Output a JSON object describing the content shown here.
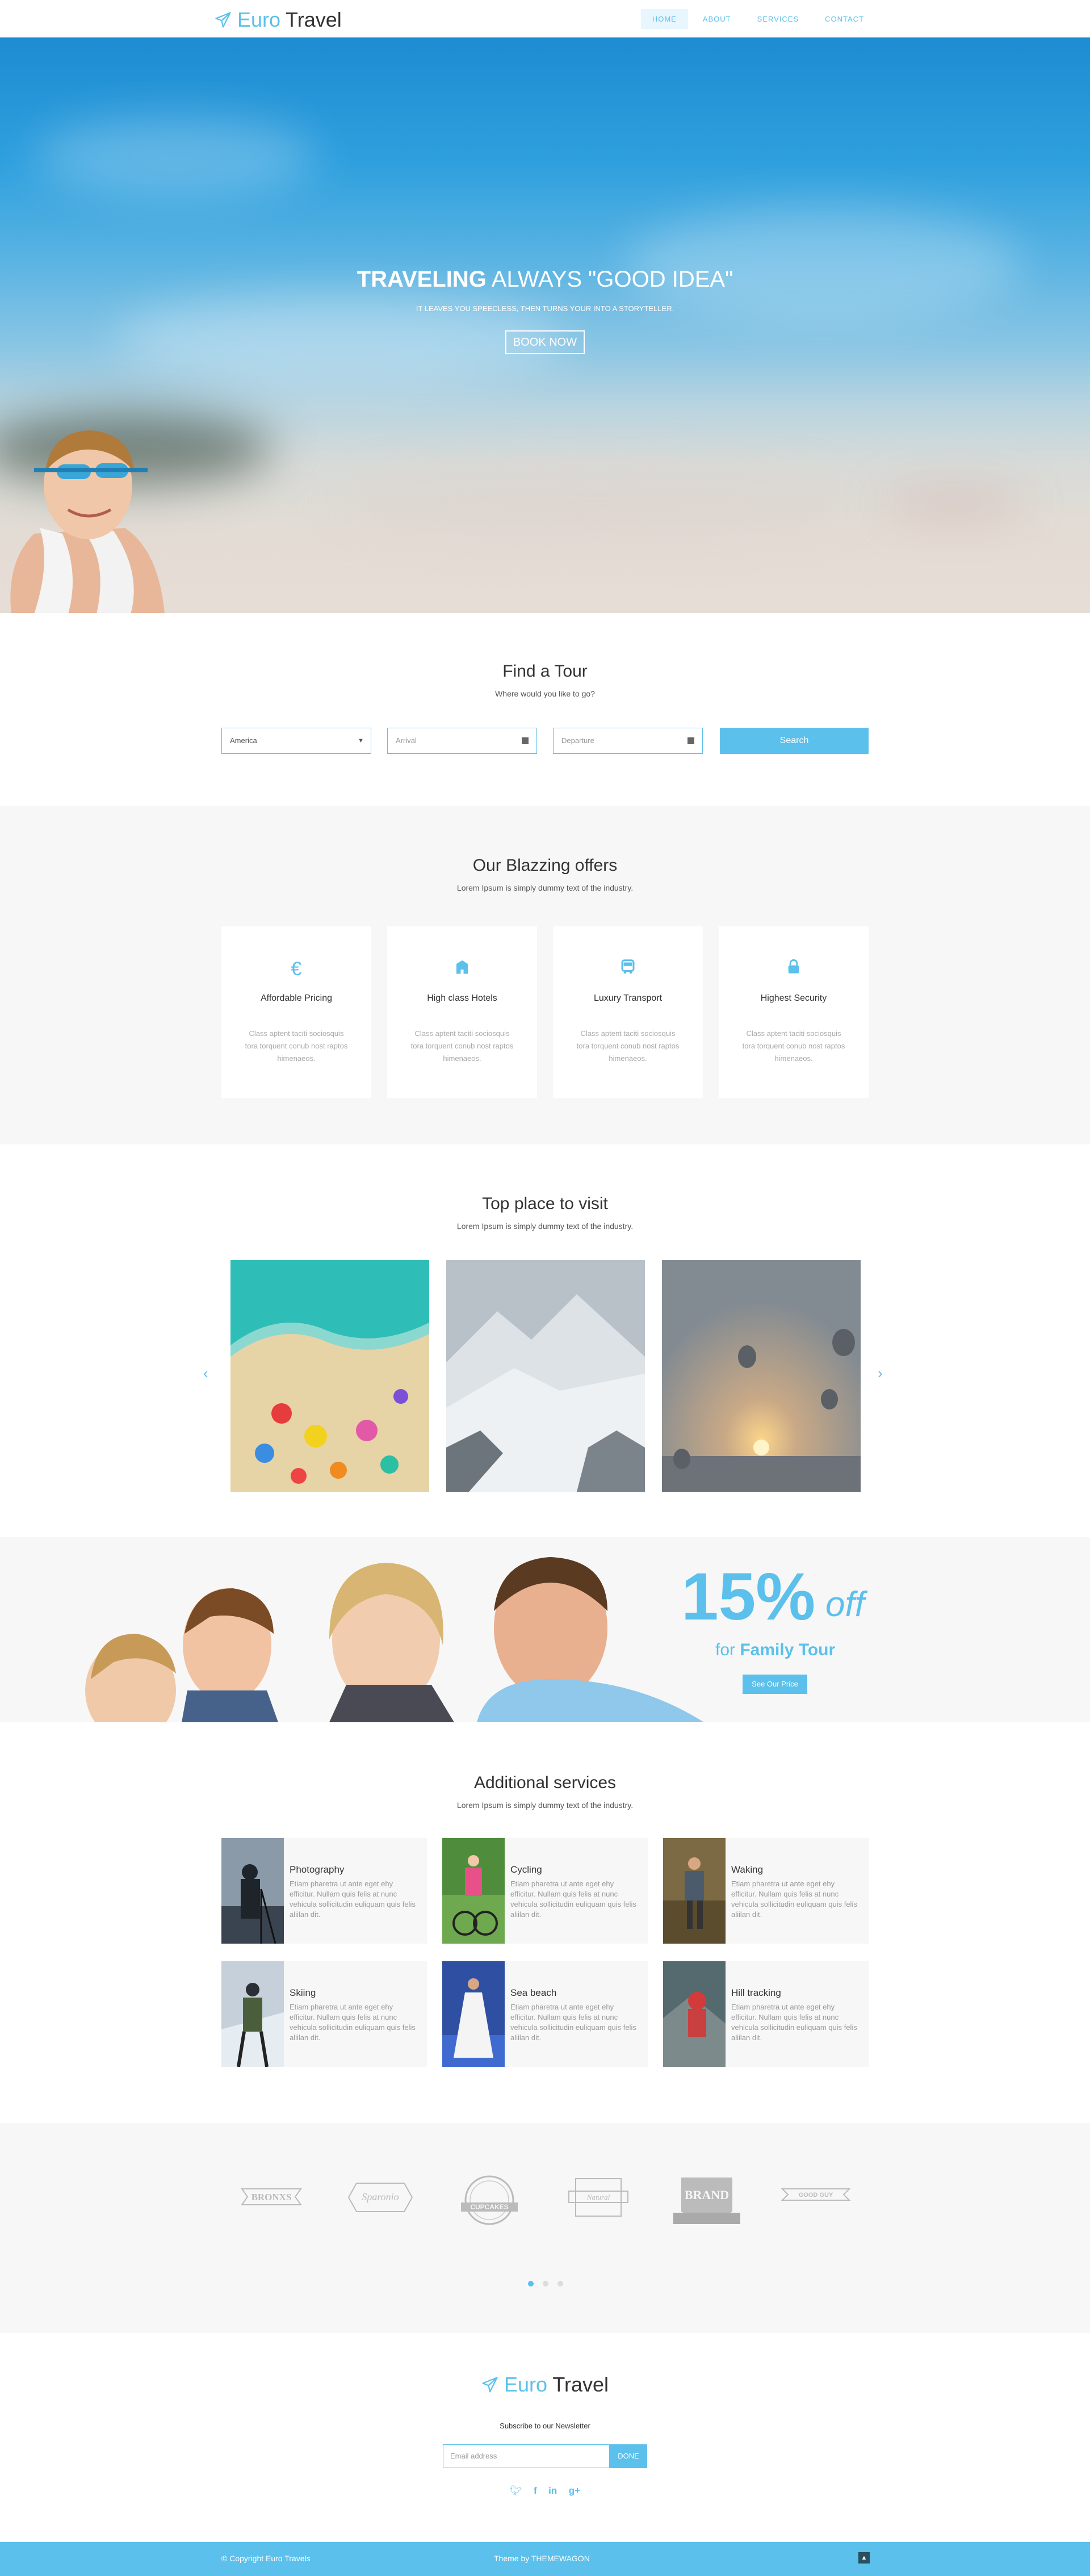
{
  "nav": {
    "logo_part1": "Euro",
    "logo_part2": "Travel",
    "items": [
      {
        "label": "HOME",
        "active": true
      },
      {
        "label": "ABOUT",
        "active": false
      },
      {
        "label": "SERVICES",
        "active": false
      },
      {
        "label": "CONTACT",
        "active": false
      }
    ]
  },
  "hero": {
    "title_bold": "TRAVELING",
    "title_rest": "ALWAYS \"GOOD IDEA\"",
    "subtitle": "IT LEAVES YOU SPEECLESS, THEN TURNS YOUR INTO A STORYTELLER.",
    "button": "BOOK NOW"
  },
  "find_tour": {
    "title": "Find a Tour",
    "subtitle": "Where would you like to go?",
    "country_value": "America",
    "arrival_placeholder": "Arrival",
    "departure_placeholder": "Departure",
    "search_button": "Search"
  },
  "offers": {
    "title": "Our Blazzing offers",
    "subtitle": "Lorem Ipsum is simply dummy text of the industry.",
    "cards": [
      {
        "icon": "euro-icon",
        "title": "Affordable Pricing",
        "desc": "Class aptent taciti sociosquis tora torquent conub nost raptos himenaeos."
      },
      {
        "icon": "hotel-icon",
        "title": "High class Hotels",
        "desc": "Class aptent taciti sociosquis tora torquent conub nost raptos himenaeos."
      },
      {
        "icon": "bus-icon",
        "title": "Luxury Transport",
        "desc": "Class aptent taciti sociosquis tora torquent conub nost raptos himenaeos."
      },
      {
        "icon": "lock-icon",
        "title": "Highest Security",
        "desc": "Class aptent taciti sociosquis tora torquent conub nost raptos himenaeos."
      }
    ]
  },
  "places": {
    "title": "Top place to visit",
    "subtitle": "Lorem Ipsum is simply dummy text of the industry."
  },
  "promo": {
    "percent": "15%",
    "off": "off",
    "for": "for",
    "family": "Family Tour",
    "button": "See Our Price"
  },
  "services": {
    "title": "Additional services",
    "subtitle": "Lorem Ipsum is simply dummy text of the industry.",
    "items": [
      {
        "title": "Photography",
        "desc": "Etiam pharetra ut ante eget ehy efficitur. Nullam quis felis at nunc vehicula sollicitudin euliquam quis felis aliilan dit."
      },
      {
        "title": "Cycling",
        "desc": "Etiam pharetra ut ante eget ehy efficitur. Nullam quis felis at nunc vehicula sollicitudin euliquam quis felis aliilan dit."
      },
      {
        "title": "Waking",
        "desc": "Etiam pharetra ut ante eget ehy efficitur. Nullam quis felis at nunc vehicula sollicitudin euliquam quis felis aliilan dit."
      },
      {
        "title": "Skiing",
        "desc": "Etiam pharetra ut ante eget ehy efficitur. Nullam quis felis at nunc vehicula sollicitudin euliquam quis felis aliilan dit."
      },
      {
        "title": "Sea beach",
        "desc": "Etiam pharetra ut ante eget ehy efficitur. Nullam quis felis at nunc vehicula sollicitudin euliquam quis felis aliilan dit."
      },
      {
        "title": "Hill tracking",
        "desc": "Etiam pharetra ut ante eget ehy efficitur. Nullam quis felis at nunc vehicula sollicitudin euliquam quis felis aliilan dit."
      }
    ]
  },
  "brands": [
    "BRONXS",
    "Sparonio",
    "CUPCAKES",
    "Natural",
    "BRAND",
    "GOOD GUY"
  ],
  "footer": {
    "logo_part1": "Euro",
    "logo_part2": "Travel",
    "newsletter_label": "Subscribe to our Newsletter",
    "email_placeholder": "Email address",
    "done_button": "DONE",
    "social": [
      "twitter-icon",
      "facebook-icon",
      "linkedin-icon",
      "google-plus-icon"
    ],
    "copyright": "© Copyright Euro Travels",
    "theme_by": "Theme by  THEMEWAGON"
  },
  "colors": {
    "accent": "#5bc0eb",
    "light_bg": "#f7f7f7"
  }
}
